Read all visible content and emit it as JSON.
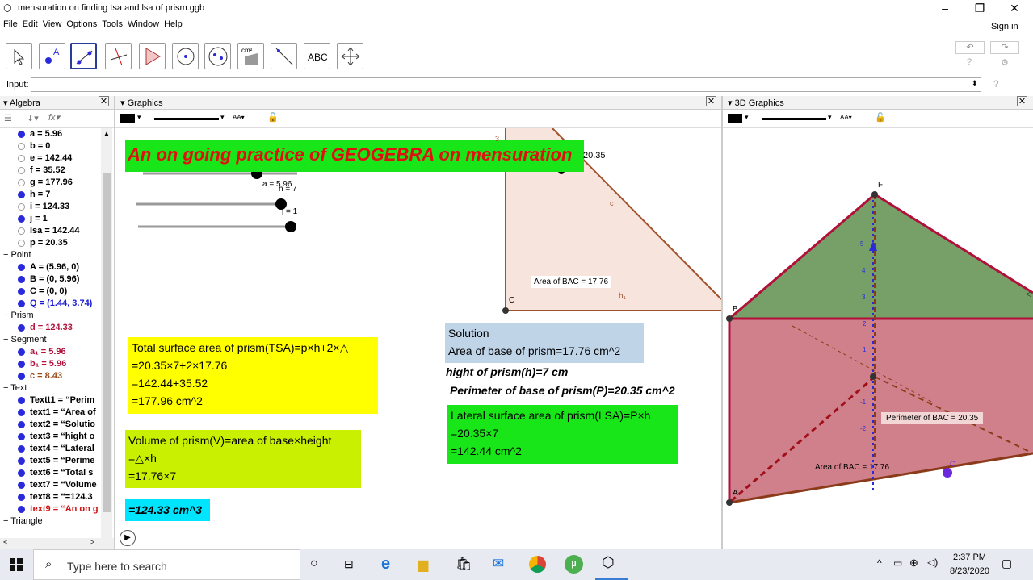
{
  "window": {
    "title": "mensuration on finding tsa and lsa of prism.ggb",
    "controls": [
      "–",
      "❐",
      "✕"
    ]
  },
  "menu": [
    "File",
    "Edit",
    "View",
    "Options",
    "Tools",
    "Window",
    "Help"
  ],
  "sign_in": "Sign in",
  "input_label": "Input:",
  "panels": {
    "algebra": "Algebra",
    "graphics": "Graphics",
    "graphics3d": "3D Graphics"
  },
  "algebra_rows": [
    {
      "t": "a = 5.96",
      "on": true
    },
    {
      "t": "b = 0",
      "on": false
    },
    {
      "t": "e = 142.44",
      "on": false
    },
    {
      "t": "f = 35.52",
      "on": false
    },
    {
      "t": "g = 177.96",
      "on": false
    },
    {
      "t": "h = 7",
      "on": true
    },
    {
      "t": "i = 124.33",
      "on": false
    },
    {
      "t": "j = 1",
      "on": true
    },
    {
      "t": "lsa = 142.44",
      "on": false
    },
    {
      "t": "p = 20.35",
      "on": false
    },
    {
      "t": "Point",
      "group": true
    },
    {
      "t": "A = (5.96, 0)",
      "on": true
    },
    {
      "t": "B = (0, 5.96)",
      "on": true
    },
    {
      "t": "C = (0, 0)",
      "on": true
    },
    {
      "t": "Q = (1.44, 3.74)",
      "on": true,
      "c": "#1a1ad6"
    },
    {
      "t": "Prism",
      "group": true
    },
    {
      "t": "d = 124.33",
      "on": true,
      "c": "#b0103a"
    },
    {
      "t": "Segment",
      "group": true
    },
    {
      "t": "a₁ = 5.96",
      "on": true,
      "c": "#b0103a"
    },
    {
      "t": "b₁ = 5.96",
      "on": true,
      "c": "#b0103a"
    },
    {
      "t": "c = 8.43",
      "on": true,
      "c": "#9b4a1a"
    },
    {
      "t": "Text",
      "group": true
    },
    {
      "t": "Textt1 = “Perim",
      "on": true
    },
    {
      "t": "text1 = “Area of",
      "on": true
    },
    {
      "t": "text2 = “Solutio",
      "on": true
    },
    {
      "t": "text3 = “hight o",
      "on": true
    },
    {
      "t": "text4 = “Lateral",
      "on": true
    },
    {
      "t": "text5 = “Perime",
      "on": true
    },
    {
      "t": "text6 = “Total s",
      "on": true
    },
    {
      "t": "text7 = “Volume",
      "on": true
    },
    {
      "t": "text8 = “=124.3",
      "on": true
    },
    {
      "t": "text9 = “An on g",
      "on": true,
      "c": "#d01010"
    },
    {
      "t": "Triangle",
      "group": true
    }
  ],
  "graphics": {
    "banner": "An on going practice of GEOGEBRA on mensuration",
    "slider_a": "a = 5.96",
    "slider_h": "h = 7",
    "slider_j": "j = 1",
    "tri_label_p": "20.35",
    "tri_label_c": "c",
    "tri_label_area": "Area of  BAC = 17.76",
    "tri_label_b1": "b₁",
    "tri_label_C": "C",
    "tri_label_3": "3",
    "tsa": [
      "Total surface area of prism(TSA)=p×h+2×△",
      "=20.35×7+2×17.76",
      "=142.44+35.52",
      "=177.96 cm^2"
    ],
    "volume": [
      "Volume of prism(V)=area of base×height",
      "=△×h",
      "=17.76×7"
    ],
    "volume_result": "=124.33 cm^3",
    "solution": [
      "Solution",
      "Area of base of prism=17.76 cm^2"
    ],
    "height": "hight of prism(h)=7 cm",
    "perimeter": "Perimeter of base of prism(P)=20.35 cm^2",
    "lsa": [
      "Lateral surface area of prism(LSA)=P×h",
      "=20.35×7",
      "=142.44 cm^2"
    ]
  },
  "graphics3d": {
    "label_F": "F",
    "label_B": "B",
    "label_A": "A",
    "label_C": "C",
    "perimeter": "Perimeter of  BAC = 20.35",
    "area": "Area of  BAC = 17.76",
    "axis_ticks": [
      "5",
      "4",
      "3",
      "2",
      "1",
      "-1",
      "-2"
    ]
  },
  "taskbar": {
    "search": "Type here to search",
    "time": "2:37 PM",
    "date": "8/23/2020"
  }
}
